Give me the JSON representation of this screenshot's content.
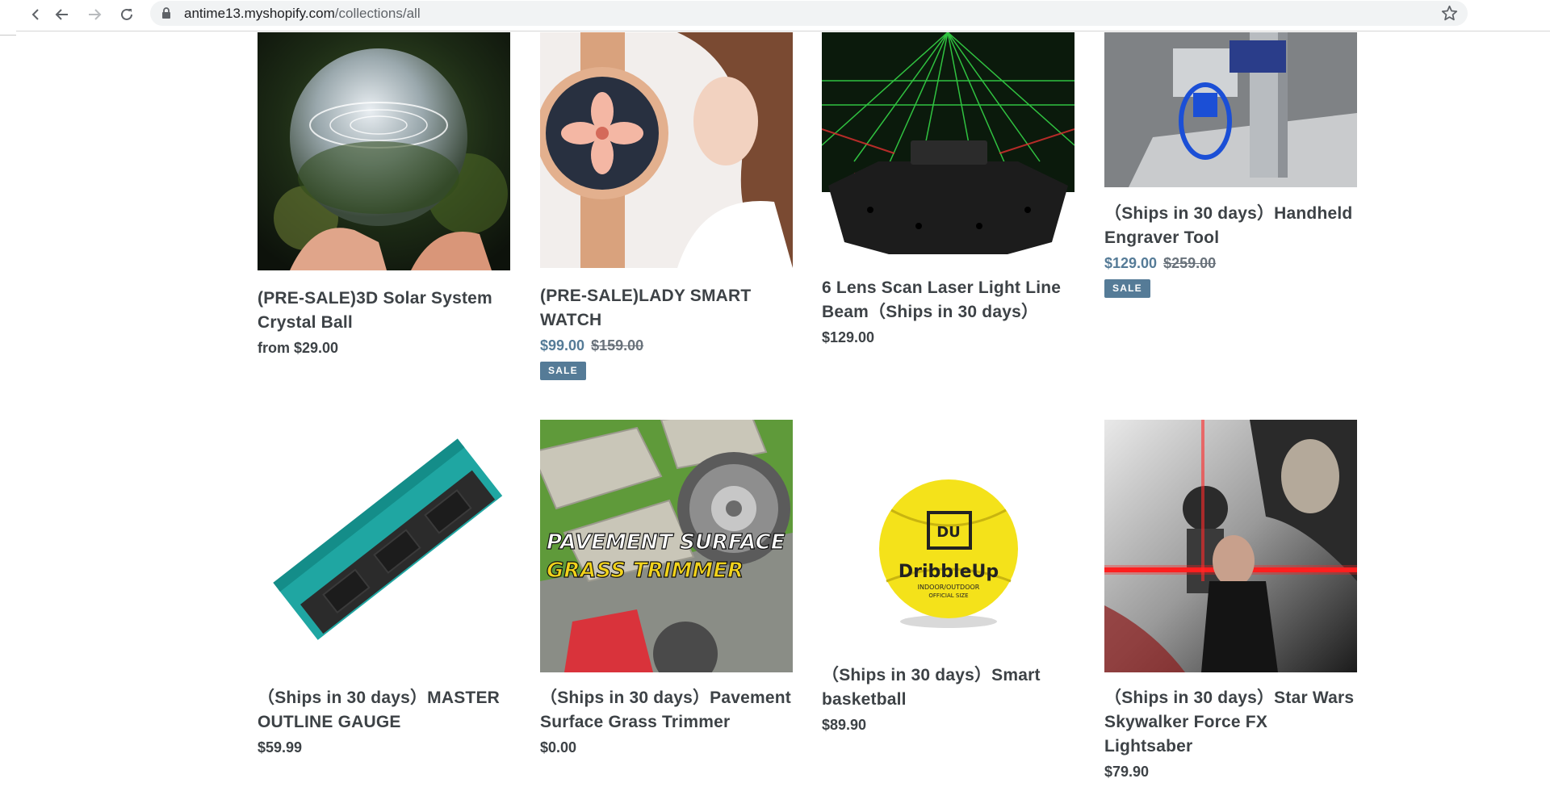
{
  "browser": {
    "url_host": "antime13.myshopify.com",
    "url_path": "/collections/all"
  },
  "products": [
    {
      "title": "(PRE-SALE)3D Solar System Crystal Ball",
      "price": "from $29.00",
      "compare_price": "",
      "badge": "",
      "image": "crystal-ball-photo"
    },
    {
      "title": "(PRE-SALE)LADY SMART WATCH",
      "price": "$99.00",
      "compare_price": "$159.00",
      "badge": "SALE",
      "image": "smart-watch-photo"
    },
    {
      "title": "6 Lens Scan Laser Light Line Beam（Ships in 30 days）",
      "price": "$129.00",
      "compare_price": "",
      "badge": "",
      "image": "laser-light-photo"
    },
    {
      "title": "（Ships in 30 days）Handheld Engraver Tool",
      "price": "$129.00",
      "compare_price": "$259.00",
      "badge": "SALE",
      "image": "engraver-tool-photo"
    },
    {
      "title": "（Ships in 30 days）MASTER OUTLINE GAUGE",
      "price": "$59.99",
      "compare_price": "",
      "badge": "",
      "image": "outline-gauge-photo"
    },
    {
      "title": "（Ships in 30 days）Pavement Surface Grass Trimmer",
      "price": "$0.00",
      "compare_price": "",
      "badge": "",
      "image": "grass-trimmer-photo",
      "image_text": [
        "PAVEMENT SURFACE",
        "GRASS TRIMMER"
      ]
    },
    {
      "title": "（Ships in 30 days）Smart basketball",
      "price": "$89.90",
      "compare_price": "",
      "badge": "",
      "image": "basketball-photo",
      "image_text": [
        "DU",
        "DribbleUp",
        "INDOOR/OUTDOOR",
        "OFFICIAL SIZE"
      ]
    },
    {
      "title": "（Ships in 30 days）Star Wars Skywalker Force FX Lightsaber",
      "price": "$79.90",
      "compare_price": "",
      "badge": "",
      "image": "lightsaber-poster-photo"
    }
  ],
  "colors": {
    "sale_price": "#557b97",
    "title_text": "#3d4246",
    "badge_bg": "#557b97"
  }
}
